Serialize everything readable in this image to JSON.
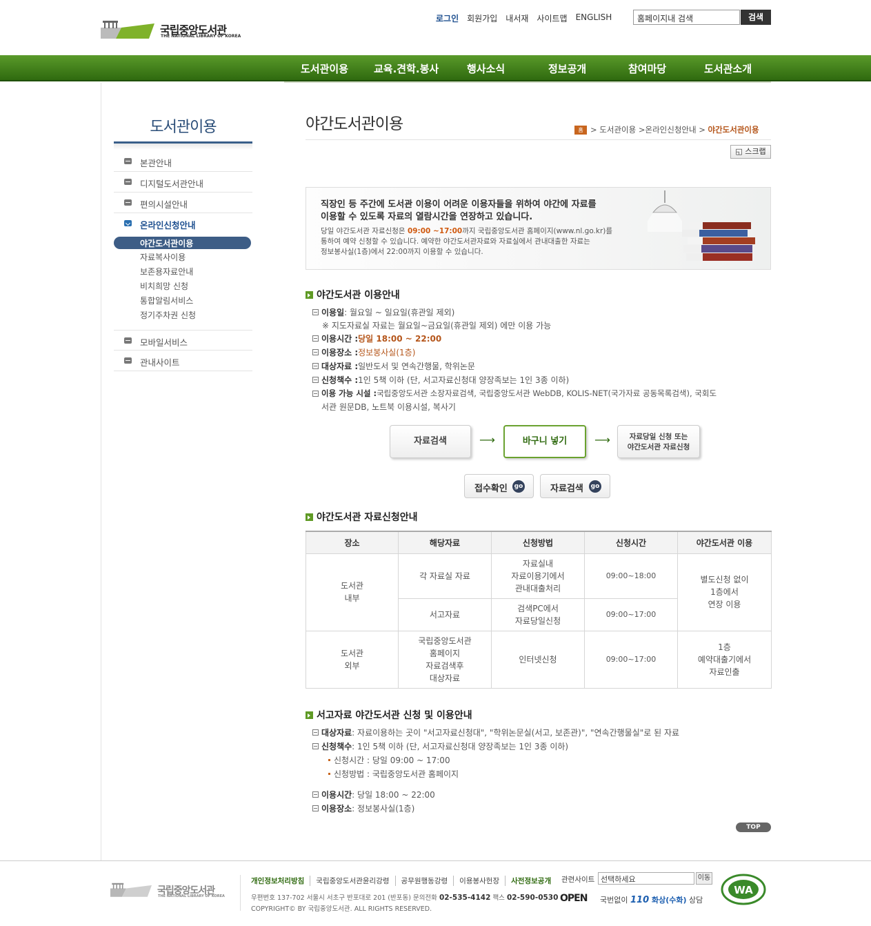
{
  "header": {
    "logo_title": "국립중앙도서관",
    "logo_sub": "THE NATIONAL LIBRARY OF KOREA",
    "util": [
      "로그인",
      "회원가입",
      "내서재",
      "사이트맵",
      "ENGLISH"
    ],
    "search_value": "홈페이지내 검색",
    "search_button": "검색"
  },
  "gnb": [
    "도서관이용",
    "교육.견학.봉사",
    "행사소식",
    "정보공개",
    "참여마당",
    "도서관소개"
  ],
  "sidebar": {
    "title": "도서관이용",
    "items": [
      "본관안내",
      "디지털도서관안내",
      "편의시설안내",
      "온라인신청안내",
      "모바일서비스",
      "관내사이트"
    ],
    "sub_items": [
      "야간도서관이용",
      "자료복사이용",
      "보존용자료안내",
      "비치희망 신청",
      "통합알림서비스",
      "정기주차권 신청"
    ]
  },
  "page": {
    "title": "야간도서관이용",
    "breadcrumb": {
      "home": "홈",
      "b1": "도서관이용",
      "b2": "온라인신청안내",
      "current": "야간도서관이용"
    },
    "scrap": "스크랩"
  },
  "banner": {
    "line1": "직장인 등 주간에 도서관 이용이 어려운 이용자들을 위하여 야간에 자료를",
    "line2": "이용할 수 있도록 자료의 열람시간을 연장하고 있습니다.",
    "d1a": "당일 야간도서관 자료신청은 ",
    "d1b": "09:00 ~17:00",
    "d1c": "까지 국립중앙도서관 홈페이지(www.nl.go.kr)를",
    "d2": "통하여 예약 신청할 수 있습니다. 예약한 야간도서관자료와 자료실에서 관내대출한 자료는",
    "d3": "정보봉사실(1층)에서 22:00까지 이용할 수 있습니다."
  },
  "sec1": {
    "title": "야간도서관 이용안내",
    "day_k": "이용일",
    "day_v": " : 월요일 ~ 일요일(휴관일 제외)",
    "day_note": "※ 지도자료실 자료는 월요일~금요일(휴관일 제외) 에만 이용 가능",
    "time_k": "이용시간 : ",
    "time_v": "당일 18:00 ~ 22:00",
    "place_k": "이용장소 : ",
    "place_v": "정보봉사실(1층)",
    "target_k": "대상자료 : ",
    "target_v": "일반도서 및 연속간행물, 학위논문",
    "count_k": "신청책수 : ",
    "count_v": "1인 5책 이하 (단, 서고자료신청대 양장족보는 1인 3종 이하)",
    "facility_k": "이용 가능 시설 : ",
    "facility_v": "국립중앙도서관 소장자료검색, 국립중앙도서관 WebDB, KOLIS-NET(국가자료 공동목록검색), 국회도",
    "facility_v2": "서관 원문DB, 노트북 이용시설, 복사기"
  },
  "flow": {
    "step1": "자료검색",
    "step2": "바구니 넣기",
    "step3a": "자료당일 신청 또는",
    "step3b": "야간도서관 자료신청",
    "arrow": "⟶",
    "btn1": "접수확인",
    "btn2": "자료검색",
    "go": "go"
  },
  "sec2": {
    "title": "야간도서관 자료신청안내",
    "headers": [
      "장소",
      "해당자료",
      "신청방법",
      "신청시간",
      "야간도서관 이용"
    ],
    "in_place_a": "도서관",
    "in_place_b": "내부",
    "r1_item": "각 자료실 자료",
    "r1_method_a": "자료실내",
    "r1_method_b": "자료이용기에서",
    "r1_method_c": "관내대출처리",
    "r1_time": "09:00~18:00",
    "in_use_a": "별도신청 없이",
    "in_use_b": "1층에서",
    "in_use_c": "연장 이용",
    "r2_item": "서고자료",
    "r2_method_a": "검색PC에서",
    "r2_method_b": "자료당일신청",
    "r2_time": "09:00~17:00",
    "out_place_a": "도서관",
    "out_place_b": "외부",
    "r3_item_a": "국립중앙도서관",
    "r3_item_b": "홈페이지",
    "r3_item_c": "자료검색후",
    "r3_item_d": "대상자료",
    "r3_method": "인터넷신청",
    "r3_time": "09:00~17:00",
    "r3_use_a": "1층",
    "r3_use_b": "예약대출기에서",
    "r3_use_c": "자료인출"
  },
  "sec3": {
    "title": "서고자료 야간도서관 신청 및 이용안내",
    "target_k": "대상자료",
    "target_v": " : 자료이용하는 곳이 \"서고자료신청대\", \"학위논문실(서고, 보존관)\", \"연속간행물실\"로 된 자료",
    "count_k": "신청책수",
    "count_v": " : 1인 5책 이하 (단, 서고자료신청대 양장족보는 1인 3종 이하)",
    "sub1": "신청시간 : 당일 09:00 ~ 17:00",
    "sub2": "신청방법 : 국립중앙도서관 홈페이지",
    "time_k": "이용시간",
    "time_v": " : 당일 18:00 ~ 22:00",
    "place_k": "이용장소",
    "place_v": " : 정보봉사실(1층)"
  },
  "top": "TOP",
  "footer": {
    "logo_title": "국립중앙도서관",
    "logo_sub": "THE NATIONAL LIBRARY OF KOREA",
    "links": [
      "개인정보처리방침",
      "국립중앙도서관윤리강령",
      "공무원행동강령",
      "이용봉사헌장",
      "사전정보공개"
    ],
    "related_label": "관련사이트",
    "select_value": "선택하세요",
    "move": "이동",
    "addr": "우편번호 137-702 서울시 서초구 반포대로 201 (반포동)  문의전화 ",
    "tel": "02-535-4142",
    "fax_label": "  팩스 ",
    "fax": "02-590-0530",
    "copyright": "COPYRIGHT© BY 국립중앙도서관. ALL RIGHTS RESERVED.",
    "open": "OPEN",
    "call_a": "국번없이 ",
    "call_n": "110",
    "call_b": " 화상(수화)",
    "call_c": " 상담",
    "wa": "WA"
  },
  "colors": {
    "green": "#2f6a0f",
    "navy": "#3d5d86",
    "orange": "#b5561b"
  }
}
